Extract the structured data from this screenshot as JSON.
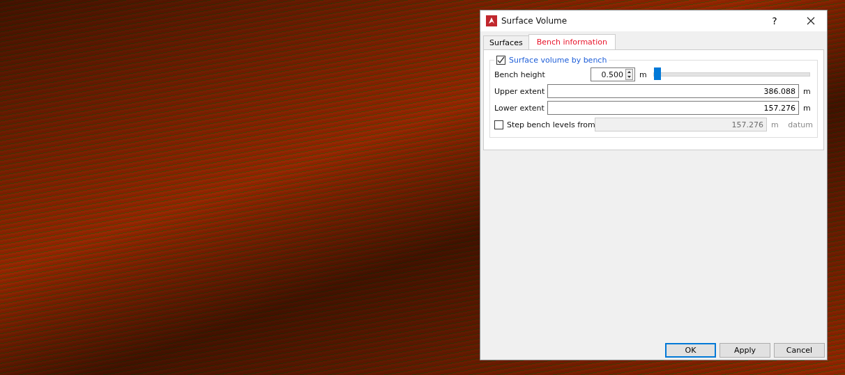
{
  "dialog": {
    "title": "Surface Volume",
    "help": "?",
    "tabs": [
      {
        "label": "Surfaces",
        "selected": false
      },
      {
        "label": "Bench information",
        "selected": true
      }
    ],
    "group": {
      "label": "Surface volume by bench",
      "checked": true,
      "bench_height": {
        "label": "Bench height",
        "value": "0.500",
        "unit": "m",
        "level": 0
      },
      "upper_extent": {
        "label": "Upper extent",
        "value": "386.088",
        "unit": "m"
      },
      "lower_extent": {
        "label": "Lower extent",
        "value": "157.276",
        "unit": "m"
      },
      "step": {
        "label": "Step bench levels from",
        "checked": false,
        "value": "157.276",
        "unit": "m",
        "suffix": "datum"
      }
    },
    "buttons": [
      {
        "label": "OK",
        "selected": true
      },
      {
        "label": "Apply",
        "selected": false
      },
      {
        "label": "Cancel",
        "selected": false
      }
    ]
  }
}
